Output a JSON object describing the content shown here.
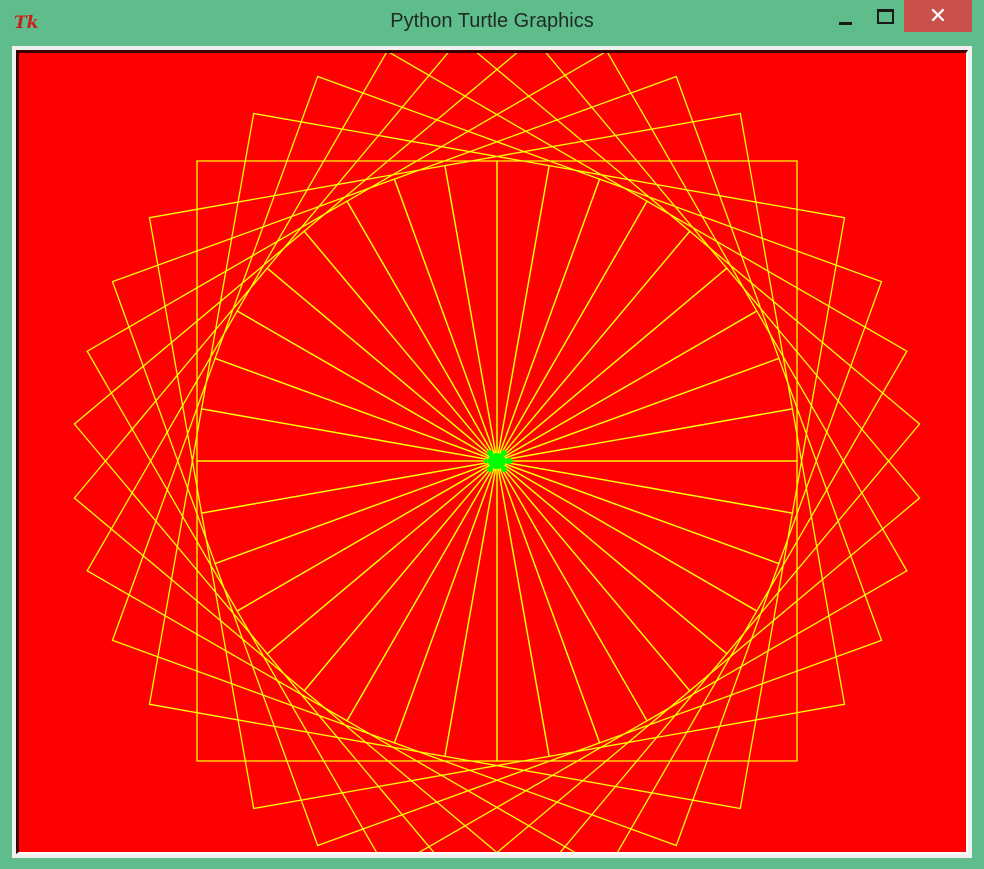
{
  "window": {
    "title": "Python Turtle Graphics",
    "app_icon": "tk-icon",
    "app_icon_text": "Tk",
    "close_symbol": "✕"
  },
  "canvas": {
    "background": "#ff0000",
    "pen_color": "#ffff00",
    "turtle_color": "#00ff00",
    "square_count": 36,
    "rotation_step_deg": 10
  }
}
